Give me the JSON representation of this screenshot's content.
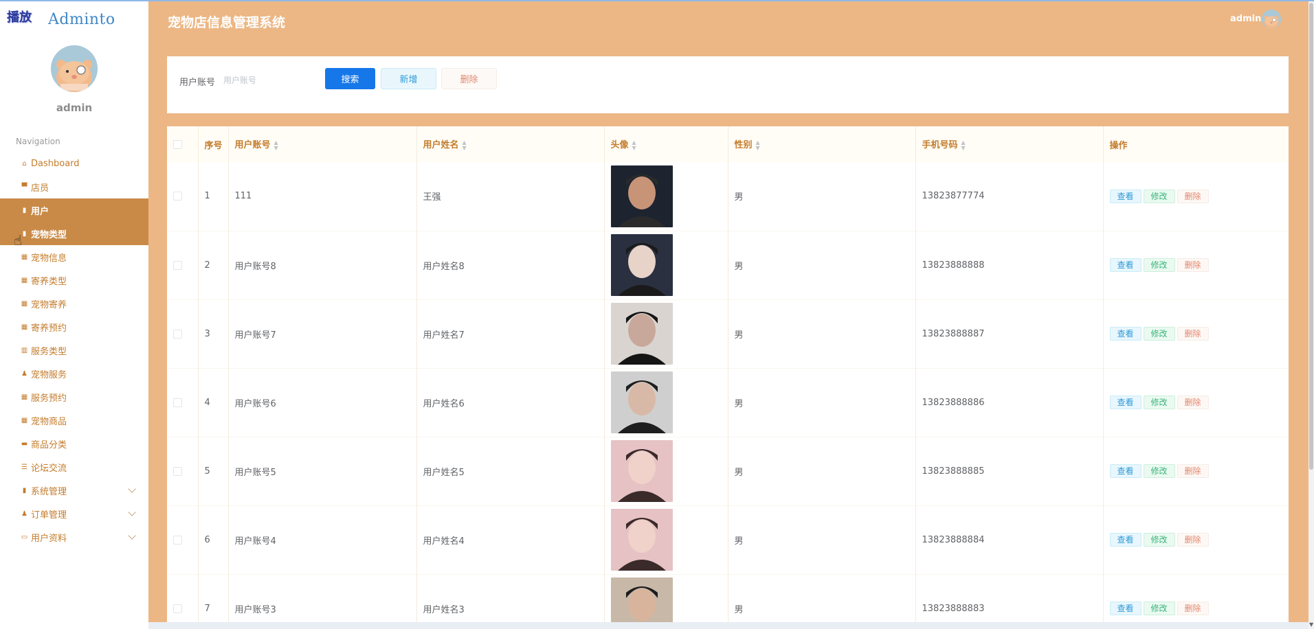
{
  "corner_mark": "播放",
  "brand": "Adminto",
  "sidebar": {
    "user_name": "admin",
    "nav_title": "Navigation",
    "items": [
      {
        "label": "Dashboard",
        "icon": "home-icon"
      },
      {
        "label": "店员",
        "icon": "shop-icon"
      },
      {
        "label": "用户",
        "icon": "clipboard-icon",
        "active": true
      },
      {
        "label": "宠物类型",
        "icon": "lock-icon",
        "active": true
      },
      {
        "label": "宠物信息",
        "icon": "grid-icon"
      },
      {
        "label": "寄养类型",
        "icon": "grid-icon"
      },
      {
        "label": "宠物寄养",
        "icon": "grid-icon"
      },
      {
        "label": "寄养预约",
        "icon": "grid-icon"
      },
      {
        "label": "服务类型",
        "icon": "bar-chart-icon"
      },
      {
        "label": "宠物服务",
        "icon": "person-icon"
      },
      {
        "label": "服务预约",
        "icon": "grid-icon"
      },
      {
        "label": "宠物商品",
        "icon": "grid-icon"
      },
      {
        "label": "商品分类",
        "icon": "briefcase-icon"
      },
      {
        "label": "论坛交流",
        "icon": "sliders-icon"
      },
      {
        "label": "系统管理",
        "icon": "clipboard-check-icon",
        "expandable": true
      },
      {
        "label": "订单管理",
        "icon": "user-icon",
        "expandable": true
      },
      {
        "label": "用户资料",
        "icon": "card-icon",
        "expandable": true
      }
    ]
  },
  "header": {
    "title": "宠物店信息管理系统",
    "admin_label": "admin"
  },
  "search": {
    "label": "用户账号",
    "placeholder": "用户账号",
    "search_button": "搜索",
    "add_button": "新增",
    "delete_button": "删除"
  },
  "table": {
    "columns": [
      "序号",
      "用户账号",
      "用户姓名",
      "头像",
      "性别",
      "手机号码",
      "操作"
    ],
    "actions": {
      "view": "查看",
      "edit": "修改",
      "delete": "删除"
    },
    "rows": [
      {
        "index": "1",
        "account": "111",
        "name": "王强",
        "gender": "男",
        "phone": "13823877774"
      },
      {
        "index": "2",
        "account": "用户账号8",
        "name": "用户姓名8",
        "gender": "男",
        "phone": "13823888888"
      },
      {
        "index": "3",
        "account": "用户账号7",
        "name": "用户姓名7",
        "gender": "男",
        "phone": "13823888887"
      },
      {
        "index": "4",
        "account": "用户账号6",
        "name": "用户姓名6",
        "gender": "男",
        "phone": "13823888886"
      },
      {
        "index": "5",
        "account": "用户账号5",
        "name": "用户姓名5",
        "gender": "男",
        "phone": "13823888885"
      },
      {
        "index": "6",
        "account": "用户账号4",
        "name": "用户姓名4",
        "gender": "男",
        "phone": "13823888884"
      },
      {
        "index": "7",
        "account": "用户账号3",
        "name": "用户姓名3",
        "gender": "男",
        "phone": "13823888883"
      }
    ]
  },
  "colors": {
    "accent": "#c47c2c",
    "header_bg": "#ecb785",
    "active_nav": "#c98a47",
    "primary": "#1677e8"
  }
}
